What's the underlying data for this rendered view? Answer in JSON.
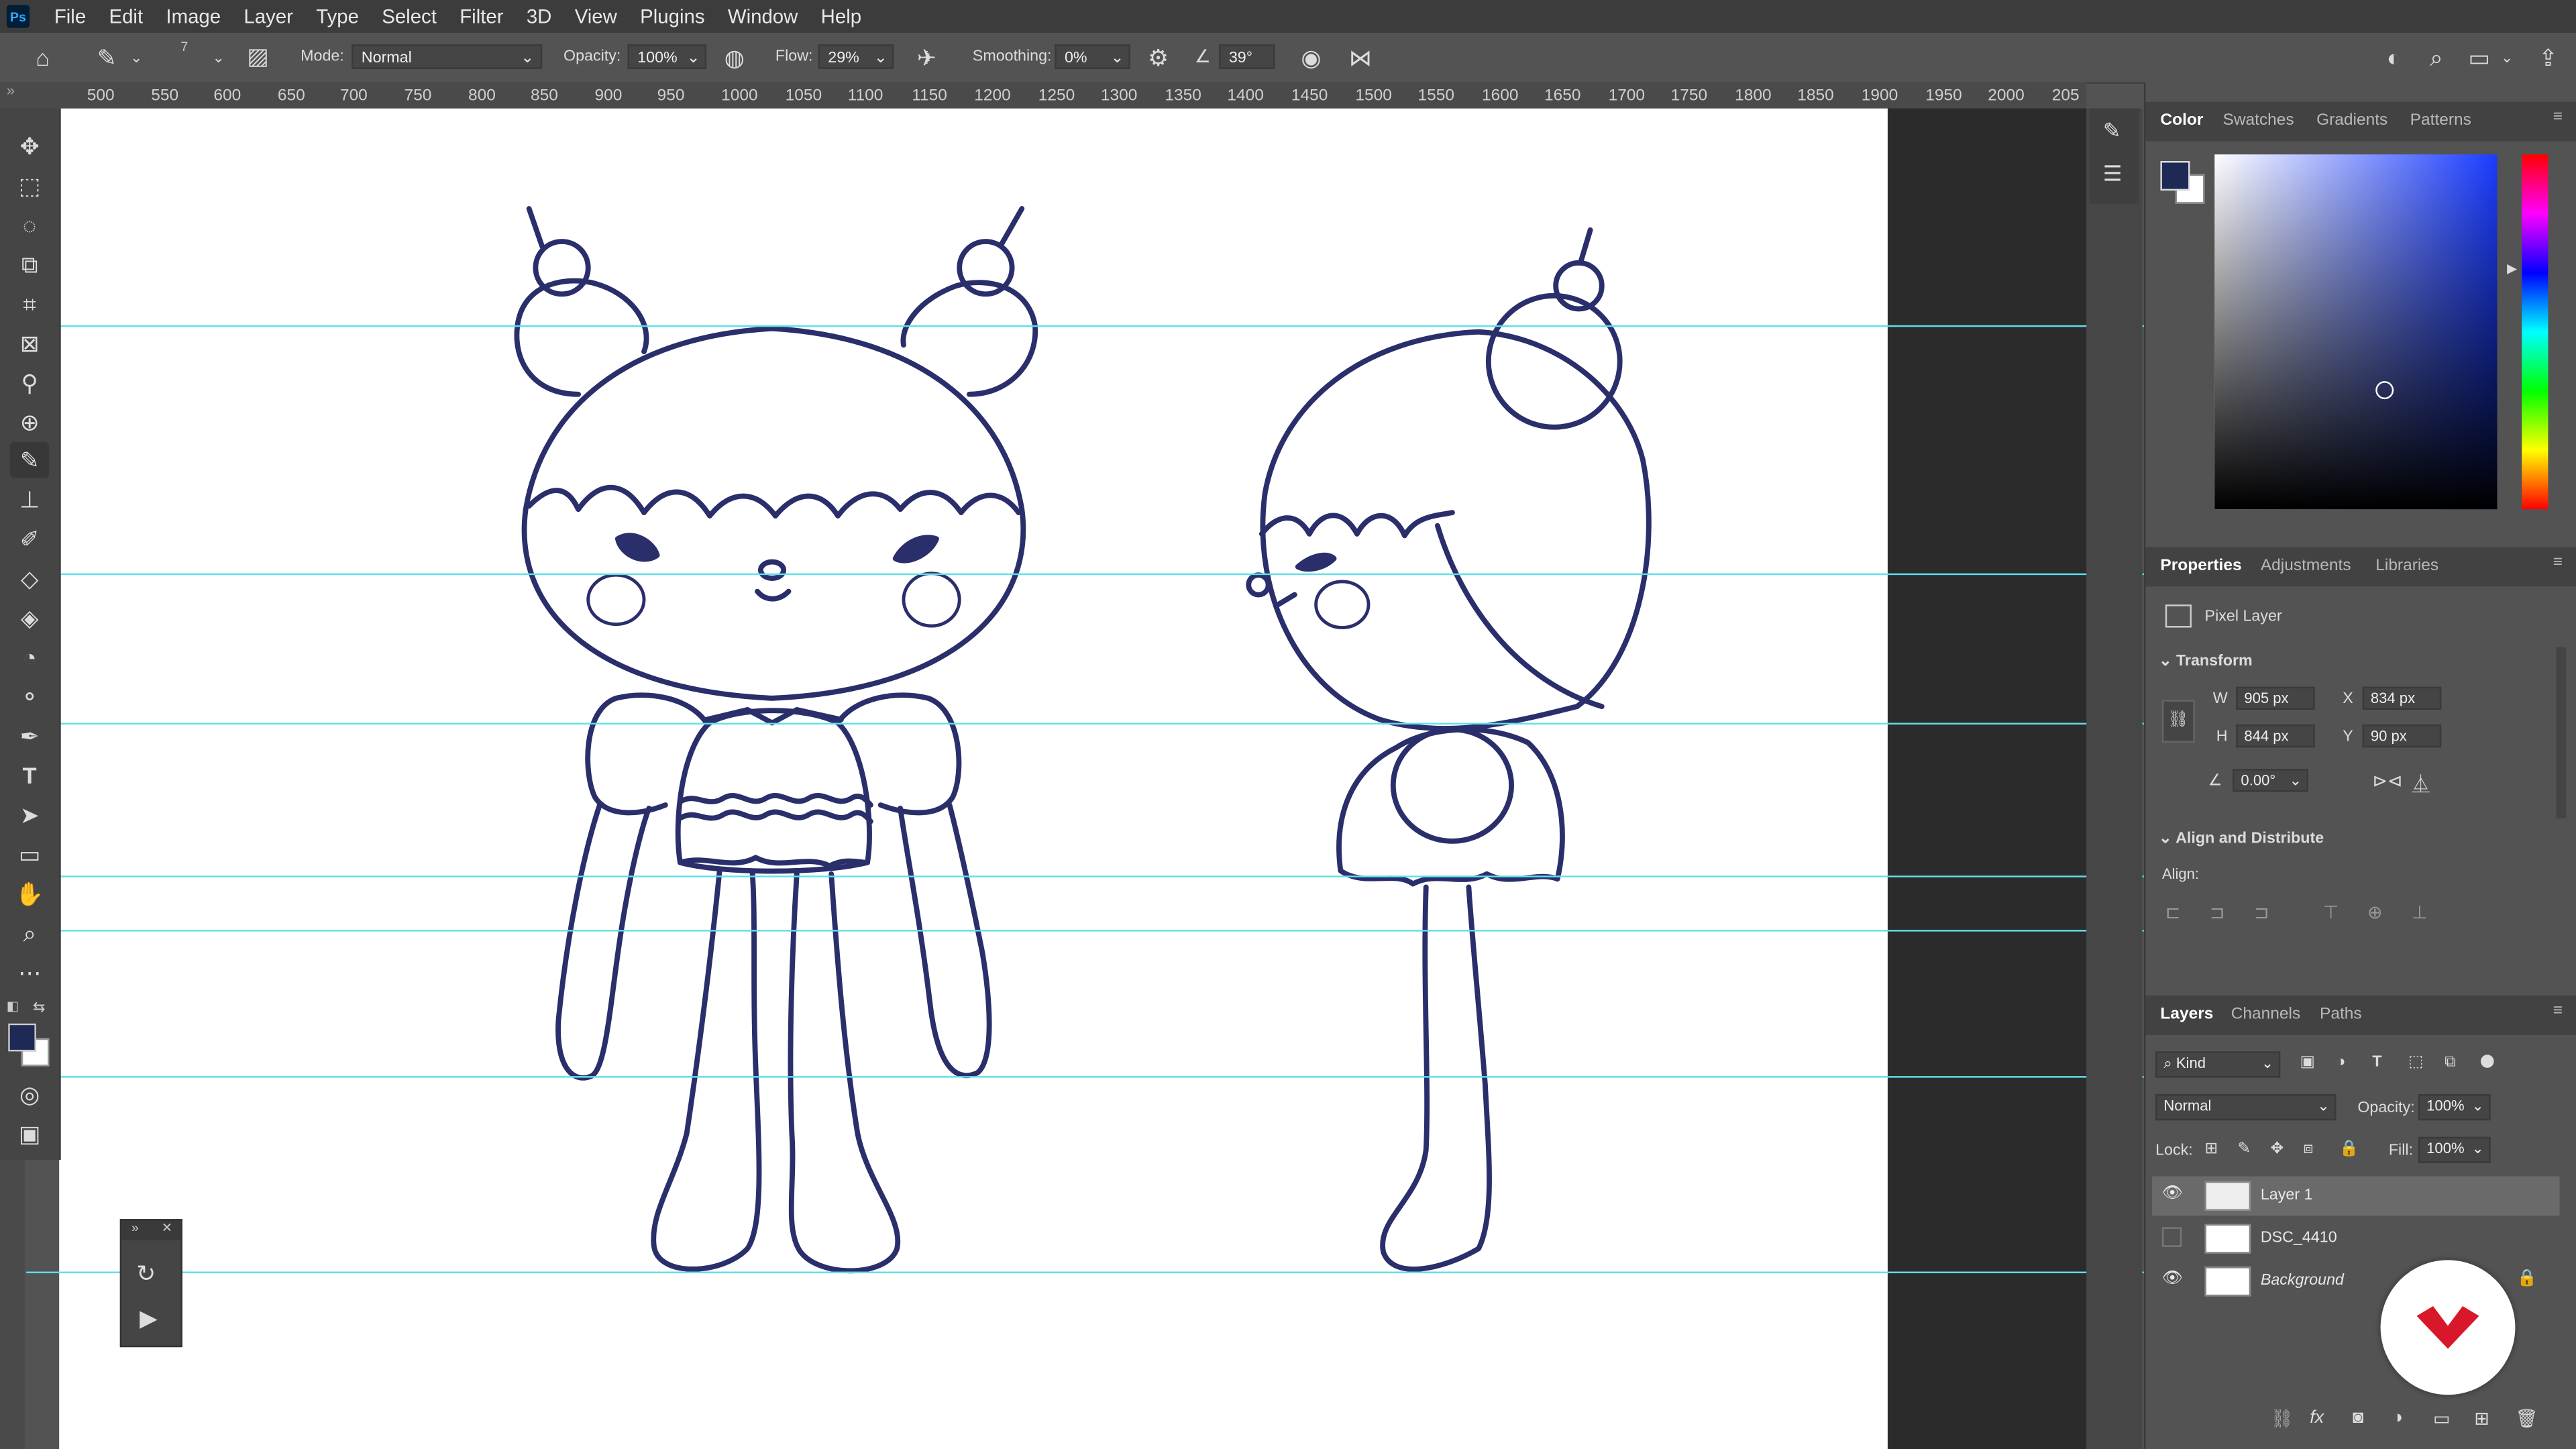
{
  "menu": [
    "File",
    "Edit",
    "Image",
    "Layer",
    "Type",
    "Select",
    "Filter",
    "3D",
    "View",
    "Plugins",
    "Window",
    "Help"
  ],
  "app_logo": "Ps",
  "options": {
    "brush_size": "7",
    "mode_label": "Mode:",
    "mode_value": "Normal",
    "opacity_label": "Opacity:",
    "opacity_value": "100%",
    "flow_label": "Flow:",
    "flow_value": "29%",
    "smoothing_label": "Smoothing:",
    "smoothing_value": "0%",
    "angle_value": "39°"
  },
  "ruler_ticks": [
    "500",
    "550",
    "600",
    "650",
    "700",
    "750",
    "800",
    "850",
    "900",
    "950",
    "1000",
    "1050",
    "1100",
    "1150",
    "1200",
    "1250",
    "1300",
    "1350",
    "1400",
    "1450",
    "1500",
    "1550",
    "1600",
    "1650",
    "1700",
    "1750",
    "1800",
    "1850",
    "1900",
    "1950",
    "2000",
    "205"
  ],
  "color_panel": {
    "tabs": [
      "Color",
      "Swatches",
      "Gradients",
      "Patterns"
    ],
    "foreground": "#1e2a55",
    "background": "#ffffff"
  },
  "properties": {
    "tabs": [
      "Properties",
      "Adjustments",
      "Libraries"
    ],
    "layer_type": "Pixel Layer",
    "transform_label": "Transform",
    "w_label": "W",
    "w": "905 px",
    "x_label": "X",
    "x": "834 px",
    "h_label": "H",
    "h": "844 px",
    "y_label": "Y",
    "y": "90 px",
    "angle": "0.00°",
    "align_header": "Align and Distribute",
    "align_label": "Align:"
  },
  "layers_panel": {
    "tabs": [
      "Layers",
      "Channels",
      "Paths"
    ],
    "filter_kind": "Kind",
    "blend_mode": "Normal",
    "opacity_label": "Opacity:",
    "opacity": "100%",
    "lock_label": "Lock:",
    "fill_label": "Fill:",
    "fill": "100%",
    "layers": [
      {
        "name": "Layer 1",
        "visible": true,
        "selected": true
      },
      {
        "name": "DSC_4410",
        "visible": false,
        "selected": false
      },
      {
        "name": "Background",
        "visible": true,
        "selected": false,
        "locked": true
      }
    ]
  },
  "colors": {
    "guide": "#5fe0ea",
    "ink": "#2a2f6b",
    "panel": "#535353",
    "accent_badge": "#d8172a"
  }
}
